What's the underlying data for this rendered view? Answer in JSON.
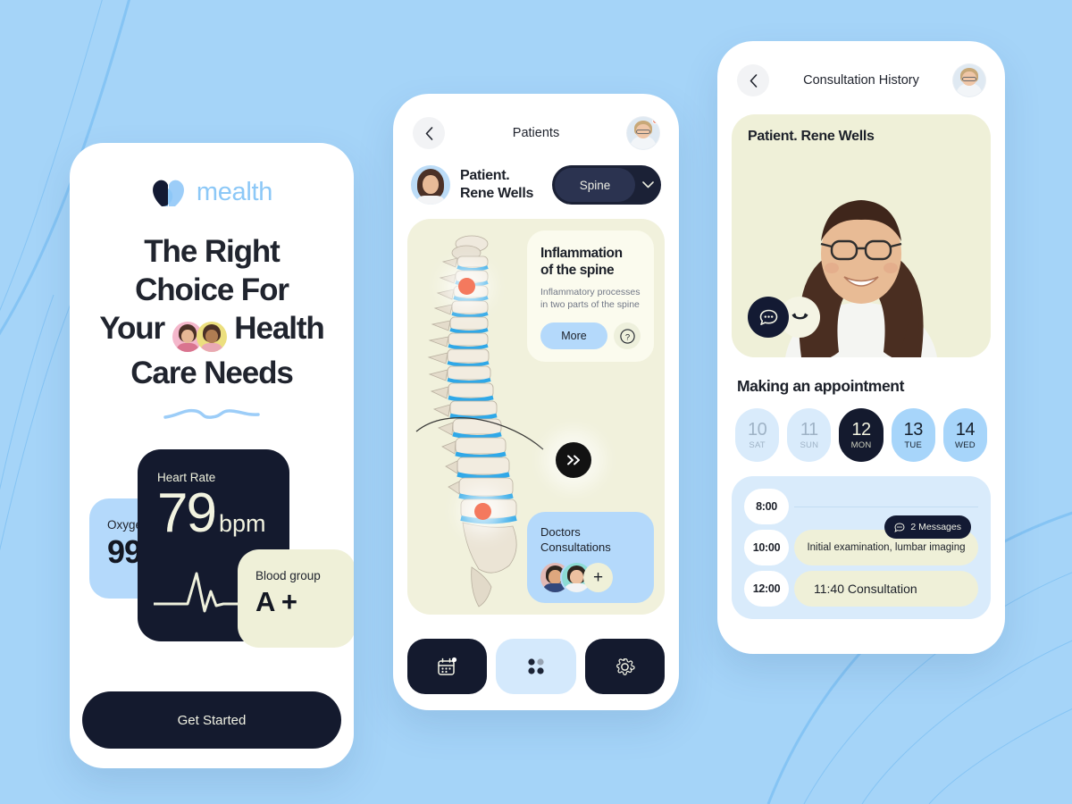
{
  "background": {
    "color": "#a5d4f8",
    "wave_color": "#6cb6f0"
  },
  "left_phone": {
    "logo": {
      "text": "mealth",
      "mark": "heart-logo-icon"
    },
    "headline_line1": "The Right",
    "headline_line2": "Choice For",
    "headline_line3a": "Your",
    "headline_line3b": "Health",
    "headline_line4": "Care Needs",
    "oxygen": {
      "label": "Oxygen",
      "value": "99"
    },
    "heart_rate": {
      "label": "Heart Rate",
      "value": "79",
      "unit": "bpm"
    },
    "blood_group": {
      "label": "Blood group",
      "value": "A +"
    },
    "cta": "Get Started"
  },
  "mid_phone": {
    "header": {
      "title": "Patients",
      "back": "chevron-left-icon",
      "avatar": "doctor-avatar"
    },
    "patient": {
      "label": "Patient.",
      "name": "Rene Wells"
    },
    "selector": {
      "value": "Spine",
      "chevron": "chevron-down-icon"
    },
    "inflammation": {
      "title_line1": "Inflammation",
      "title_line2": "of the spine",
      "desc": "Inflammatory processes in two parts of the spine",
      "more": "More",
      "help": "?"
    },
    "next_button": "»",
    "doctors": {
      "title_line1": "Doctors",
      "title_line2": "Consultations",
      "add": "+"
    },
    "tabs": [
      {
        "name": "calendar-tab",
        "icon": "calendar-icon",
        "state": "dark"
      },
      {
        "name": "grid-tab",
        "icon": "grid-icon",
        "state": "active"
      },
      {
        "name": "settings-tab",
        "icon": "gear-icon",
        "state": "dark"
      }
    ]
  },
  "right_phone": {
    "header": {
      "title": "Consultation History",
      "back": "chevron-left-icon",
      "avatar": "doctor-avatar"
    },
    "video": {
      "title": "Patient. Rene Wells",
      "chat_icon": "chat-bubble-icon",
      "end_icon": "phone-hangup-icon"
    },
    "appointment_title": "Making an appointment",
    "dates": [
      {
        "day": "10",
        "weekday": "SAT",
        "state": "dim"
      },
      {
        "day": "11",
        "weekday": "SUN",
        "state": "dim"
      },
      {
        "day": "12",
        "weekday": "MON",
        "state": "selected"
      },
      {
        "day": "13",
        "weekday": "TUE",
        "state": "upcoming"
      },
      {
        "day": "14",
        "weekday": "WED",
        "state": "upcoming"
      }
    ],
    "schedule": [
      {
        "time": "8:00",
        "event": ""
      },
      {
        "time": "10:00",
        "event": "Initial examination, lumbar imaging"
      },
      {
        "time": "12:00",
        "event": "11:40  Consultation"
      }
    ],
    "messages_badge": "2 Messages"
  }
}
